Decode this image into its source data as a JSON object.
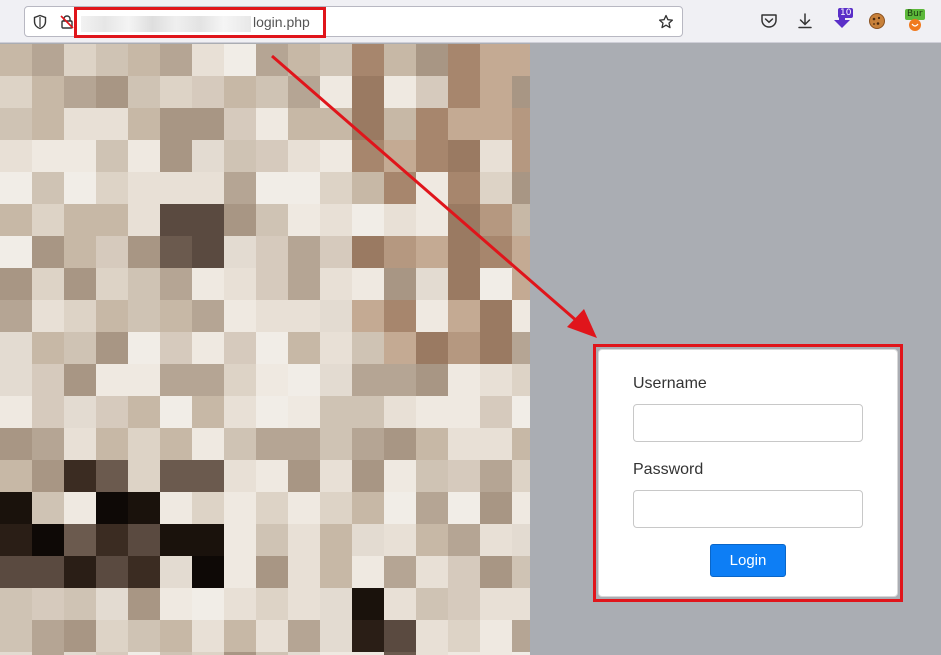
{
  "browser": {
    "url_visible": "login.php",
    "badge_count": "10",
    "ext_label": "Bur"
  },
  "login": {
    "username_label": "Username",
    "username_value": "",
    "password_label": "Password",
    "password_value": "",
    "submit_label": "Login"
  },
  "colors": {
    "highlight": "#e0151b",
    "button": "#0d7ef5",
    "page_background": "#aaadb3"
  }
}
